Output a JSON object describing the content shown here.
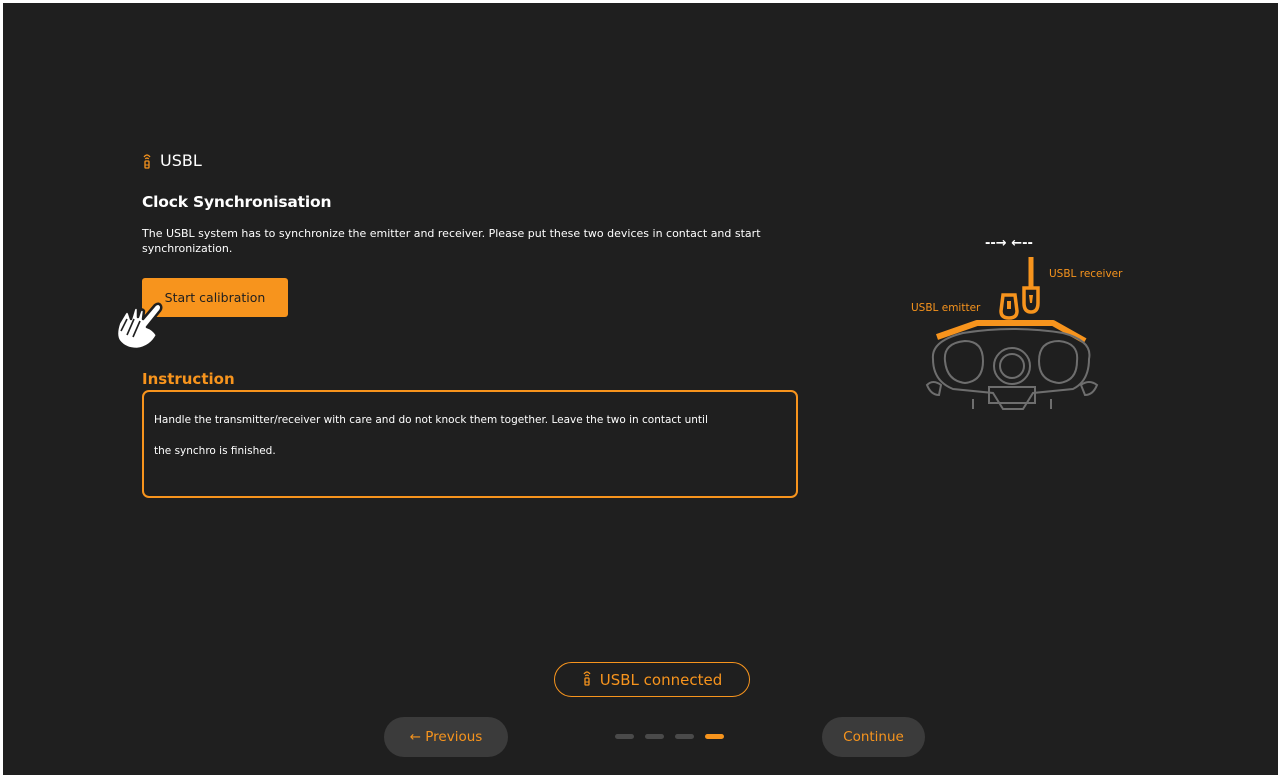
{
  "section": {
    "icon": "usbl-beacon-icon",
    "title": "USBL"
  },
  "calibration": {
    "heading": "Clock Synchronisation",
    "description": "The USBL system has to synchronize the emitter and receiver. Please put these two devices in contact and start synchronization.",
    "start_button": "Start calibration"
  },
  "instruction": {
    "label": "Instruction",
    "text_line1": "Handle the transmitter/receiver with care and do not knock them together. Leave the two in contact until",
    "text_line2": "the synchro is finished."
  },
  "diagram": {
    "emitter_label": "USBL emitter",
    "receiver_label": "USBL receiver",
    "contact_arrows": "--→ ←--"
  },
  "status": {
    "icon": "usbl-beacon-icon",
    "label": "USBL connected"
  },
  "navigation": {
    "previous_label": "← Previous",
    "continue_label": "Continue",
    "steps_total": 4,
    "current_step": 4
  },
  "colors": {
    "background": "#1f1f1f",
    "accent": "#f7941d",
    "nav_button": "#3b3b3b",
    "inactive_step": "#4a4a4a"
  }
}
